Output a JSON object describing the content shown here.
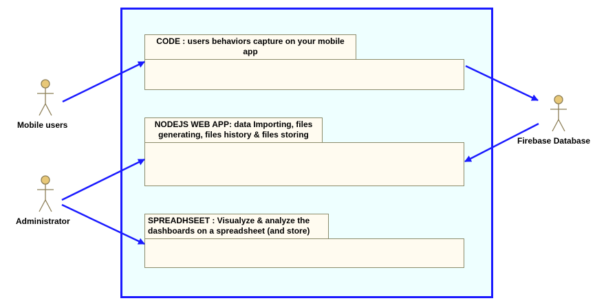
{
  "colors": {
    "boundary_border": "#1a1aff",
    "boundary_fill": "#eeffff",
    "package_fill": "#fffbf0",
    "package_border": "#8b8b6a",
    "arrow": "#1a1aff",
    "actor_head": "#e8c878"
  },
  "actors": {
    "mobile_users": {
      "label": "Mobile users",
      "icon": "stick-figure-icon"
    },
    "administrator": {
      "label": "Administrator",
      "icon": "stick-figure-icon"
    },
    "firebase": {
      "label": "Firebase Database",
      "icon": "stick-figure-icon"
    }
  },
  "packages": {
    "code": {
      "title_line1": "CODE : users behaviors capture on your mobile",
      "title_line2": "app"
    },
    "nodejs": {
      "title_line1": "NODEJS WEB APP: data Importing, files",
      "title_line2": "generating, files history & files storing"
    },
    "spreadsheet": {
      "title_line1": "SPREADHSEET : Visualyze & analyze the",
      "title_line2": "dashboards on a spreadsheet (and store)"
    }
  }
}
